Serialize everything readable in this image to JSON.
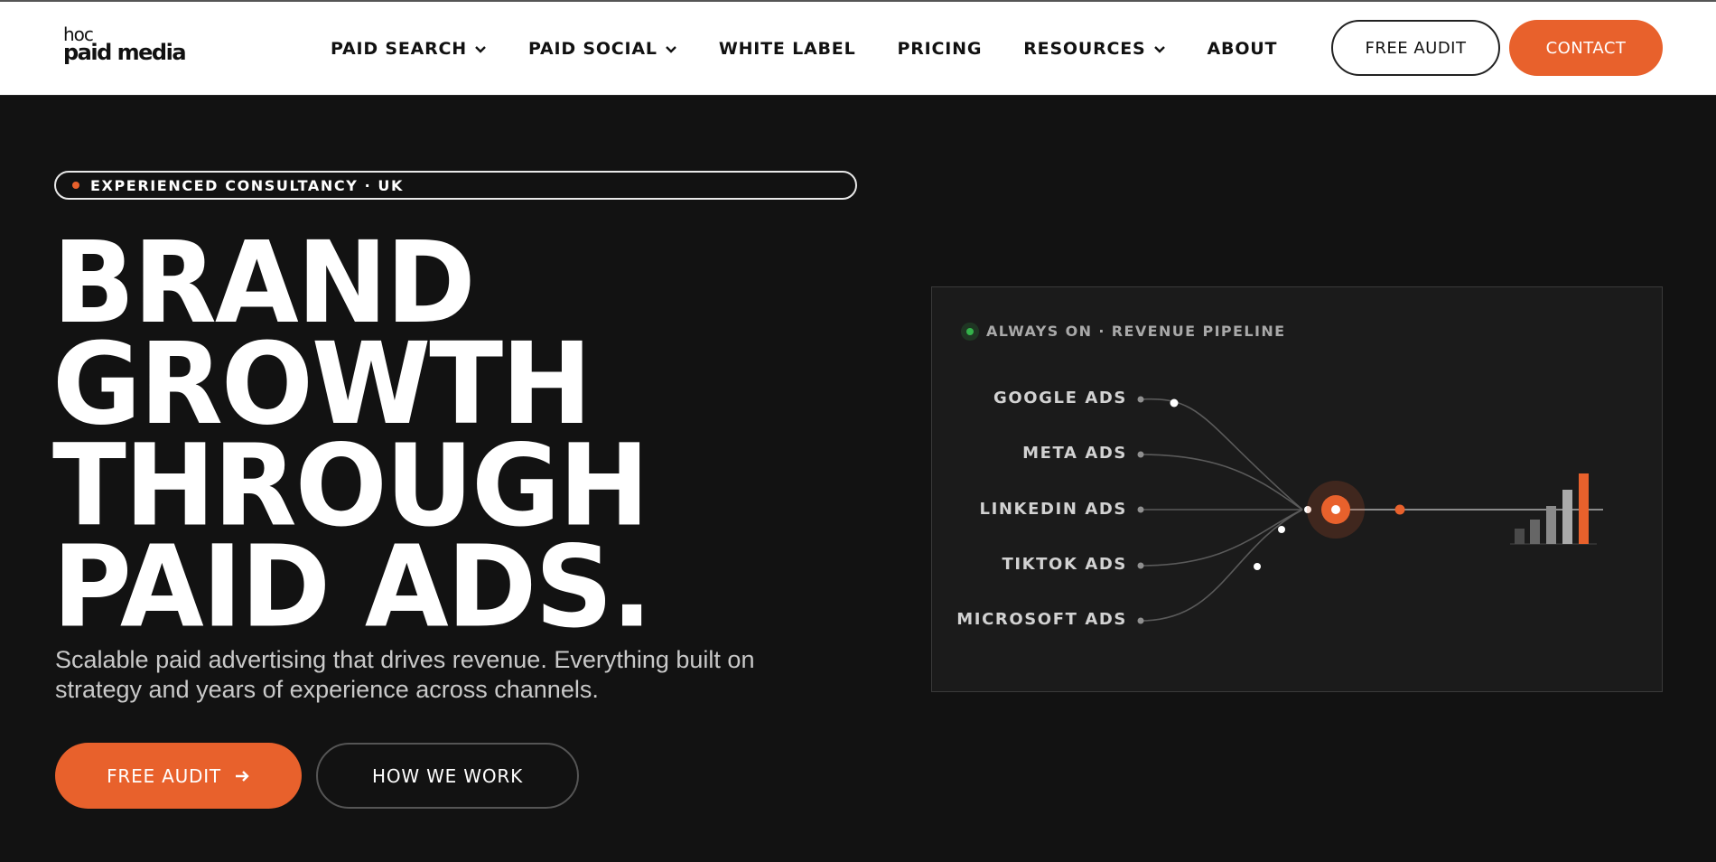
{
  "brand": {
    "logo_top": "hoc",
    "logo_bottom": "paid media"
  },
  "nav": {
    "items": [
      {
        "label": "PAID SEARCH",
        "dropdown": true
      },
      {
        "label": "PAID SOCIAL",
        "dropdown": true
      },
      {
        "label": "WHITE LABEL",
        "dropdown": false
      },
      {
        "label": "PRICING",
        "dropdown": false
      },
      {
        "label": "RESOURCES",
        "dropdown": true
      },
      {
        "label": "ABOUT",
        "dropdown": false
      }
    ],
    "free_audit": "FREE AUDIT",
    "contact": "CONTACT"
  },
  "hero": {
    "tag": "EXPERIENCED CONSULTANCY · UK",
    "headline": [
      "BRAND",
      "GROWTH",
      "THROUGH",
      "PAID ADS."
    ],
    "subtext": "Scalable paid advertising that drives revenue. Everything built on strategy and years of experience across channels.",
    "cta_primary": "FREE AUDIT",
    "cta_secondary": "HOW WE WORK"
  },
  "pipeline": {
    "status": "ALWAYS ON · REVENUE PIPELINE",
    "channels": [
      "GOOGLE ADS",
      "META ADS",
      "LINKEDIN ADS",
      "TIKTOK ADS",
      "MICROSOFT ADS"
    ]
  },
  "colors": {
    "accent": "#e8612c",
    "dark": "#121212",
    "panel": "#1b1b1b",
    "status_green": "#34b24a"
  }
}
